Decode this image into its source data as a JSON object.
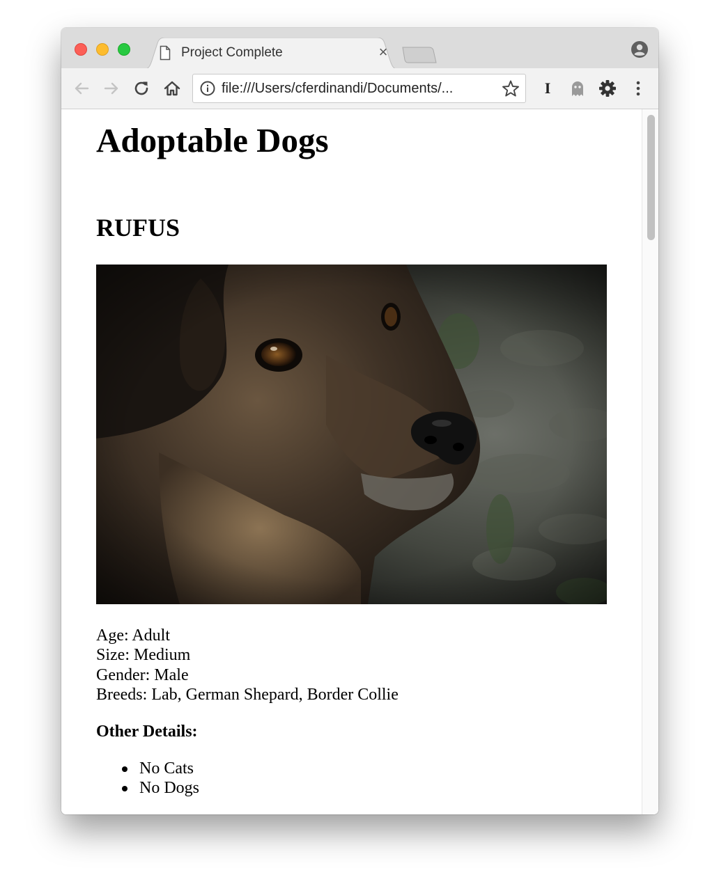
{
  "browser": {
    "tab": {
      "title": "Project Complete",
      "close_glyph": "×"
    },
    "address_bar": {
      "url": "file:///Users/cferdinandi/Documents/..."
    },
    "extension_label": "I",
    "icons": [
      "back-icon",
      "forward-icon",
      "reload-icon",
      "home-icon",
      "info-icon",
      "star-icon",
      "ghost-icon",
      "gear-icon",
      "more-icon",
      "profile-icon",
      "page-icon"
    ],
    "colors": {
      "close": "#fc5f57",
      "minimize": "#fdbc2e",
      "zoom": "#28c941",
      "tabstrip": "#dcdcdc",
      "toolbar": "#f2f2f2"
    }
  },
  "page": {
    "title": "Adoptable Dogs",
    "dog": {
      "name": "RUFUS",
      "details": [
        "Age: Adult",
        "Size: Medium",
        "Gender: Male",
        "Breeds: Lab, German Shepard, Border Collie"
      ],
      "other_details_heading": "Other Details:",
      "other_details": [
        "No Cats",
        "No Dogs"
      ]
    }
  }
}
